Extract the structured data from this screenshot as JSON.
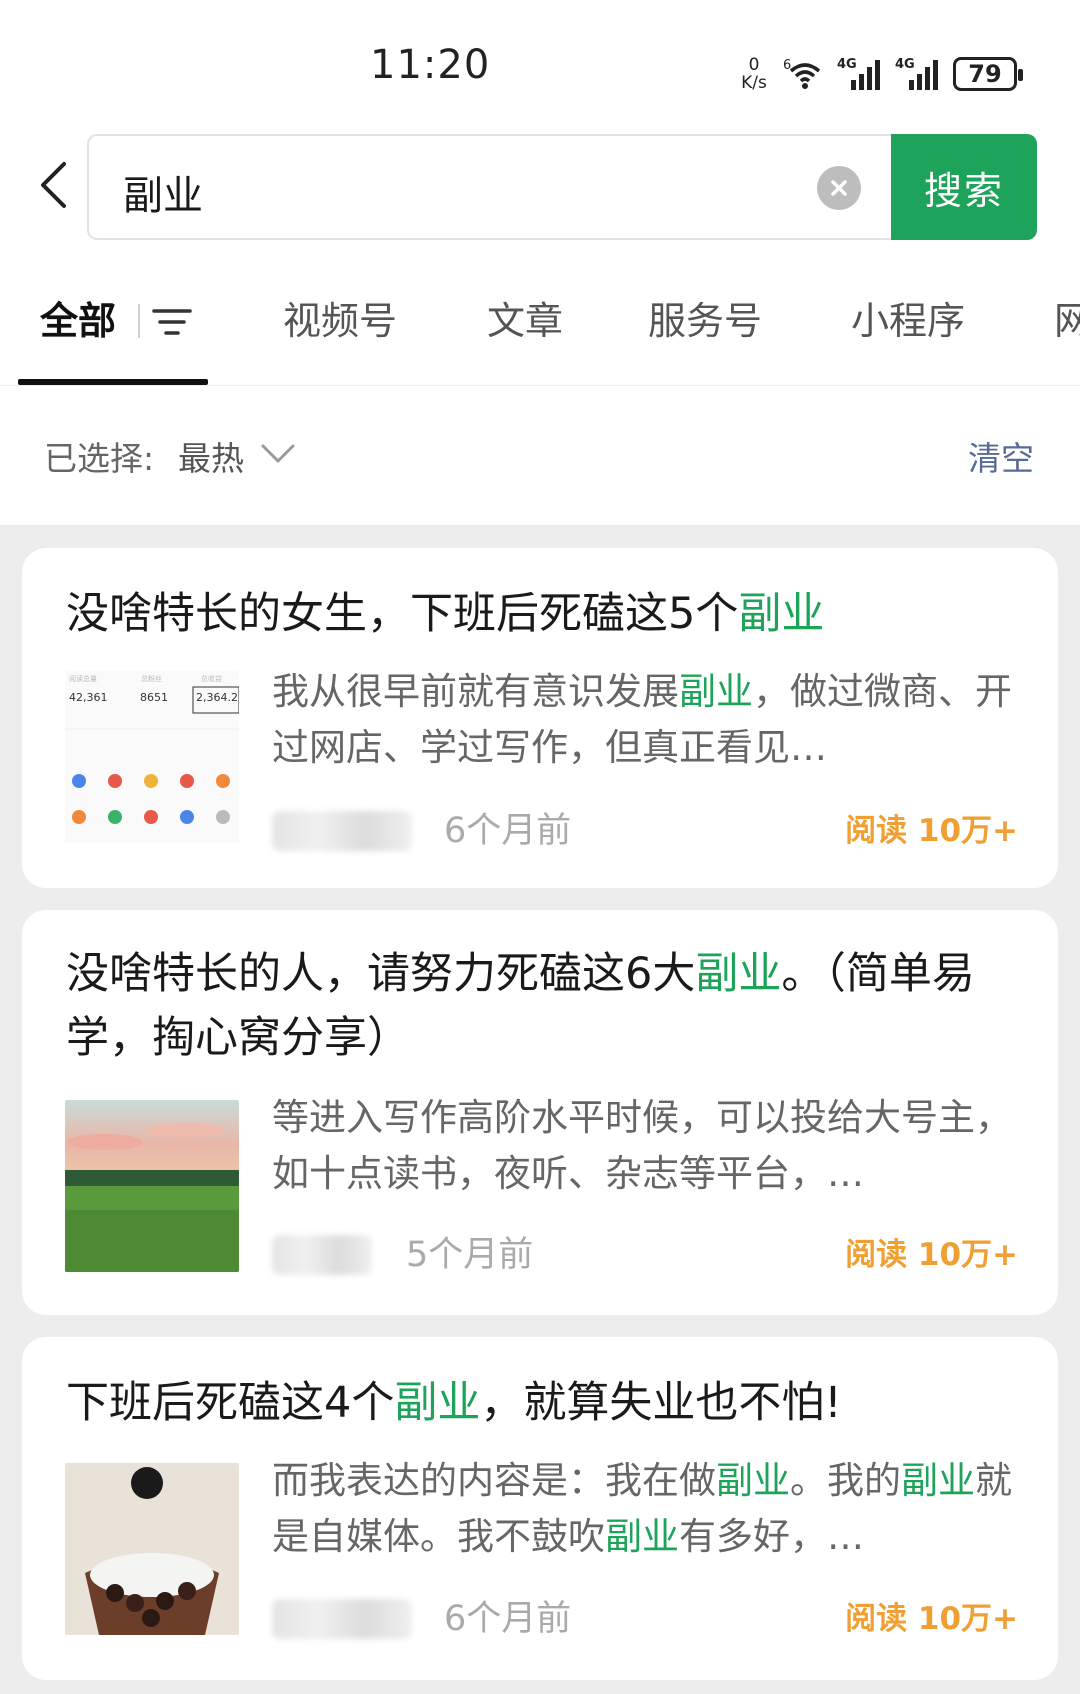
{
  "status_bar": {
    "time": "11:20",
    "netspeed_value": "0",
    "netspeed_unit": "K/s",
    "wifi_badge": "6",
    "signal_1": "4G",
    "signal_2": "4G",
    "battery": "79",
    "icons": [
      "wifi-icon",
      "signal-icon",
      "signal-icon",
      "battery-icon"
    ]
  },
  "search": {
    "query": "副业",
    "button_label": "搜索"
  },
  "tabs": [
    {
      "label": "全部",
      "active": true
    },
    {
      "label": "视频号"
    },
    {
      "label": "文章"
    },
    {
      "label": "服务号"
    },
    {
      "label": "小程序"
    },
    {
      "label": "网"
    }
  ],
  "filter": {
    "label": "已选择:",
    "value": "最热",
    "clear": "清空"
  },
  "results": [
    {
      "title_before": "没啥特长的女生，下班后死磕这5个",
      "title_hl": "副业",
      "title_after": "",
      "snippet_1": "我从很早前就有意识发展",
      "snippet_hl_1": "副业",
      "snippet_2": "，做过微商、开过网店、学过写作，但真正看见…",
      "time": "6个月前",
      "reads": "阅读 10万+",
      "thumb": {
        "stat_1": "42,361",
        "stat_2": "8651",
        "stat_3": "2,364.2"
      }
    },
    {
      "title_before": "没啥特长的人，请努力死磕这6大",
      "title_hl": "副业",
      "title_after": "。（简单易学，掏心窝分享）",
      "snippet_1": "等进入写作高阶水平时候，可以投给大号主，如十点读书，夜听、杂志等平台，…",
      "time": "5个月前",
      "reads": "阅读 10万+"
    },
    {
      "title_before": "下班后死磕这4个",
      "title_hl": "副业",
      "title_after": "，就算失业也不怕!",
      "snippet_1": "而我表达的内容是：我在做",
      "snippet_hl_1": "副业",
      "snippet_2": "。我的",
      "snippet_hl_2": "副业",
      "snippet_3": "就是自媒体。我不鼓吹",
      "snippet_hl_3": "副业",
      "snippet_4": "有多好，…",
      "time": "6个月前",
      "reads": "阅读 10万+"
    }
  ],
  "colors": {
    "accent_green": "#1ea35a",
    "link_blue": "#576b95",
    "read_orange": "#f0a033"
  }
}
